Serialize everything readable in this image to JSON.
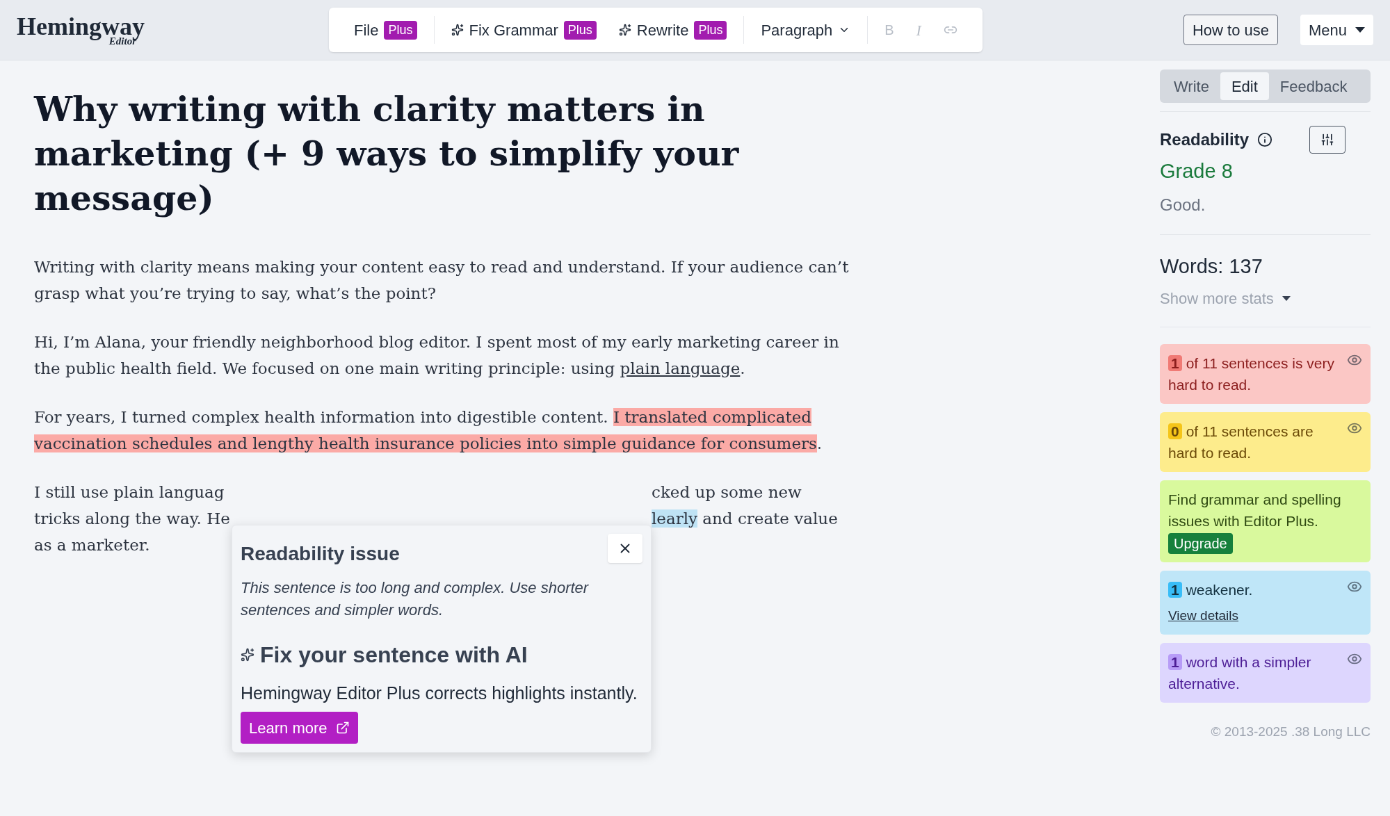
{
  "logo": {
    "name": "Hemingway",
    "sub": "Editor"
  },
  "toolbar": {
    "groups": [
      {
        "items": [
          {
            "kind": "menu",
            "label": "File",
            "badge": "Plus",
            "sparkle": false
          }
        ]
      },
      {
        "items": [
          {
            "kind": "menu",
            "label": "Fix Grammar",
            "badge": "Plus",
            "sparkle": true
          },
          {
            "kind": "menu",
            "label": "Rewrite",
            "badge": "Plus",
            "sparkle": true
          }
        ]
      },
      {
        "items": [
          {
            "kind": "dropdown",
            "label": "Paragraph"
          }
        ]
      },
      {
        "items": [
          {
            "kind": "bold",
            "label": "B"
          },
          {
            "kind": "italic",
            "label": "I"
          },
          {
            "kind": "link"
          }
        ]
      }
    ]
  },
  "header_buttons": [
    {
      "kind": "outline",
      "label": "How to use"
    },
    {
      "kind": "dropdown",
      "label": "Menu"
    }
  ],
  "document": {
    "title": "Why writing with clarity matters in marketing (+ 9 ways to simplify your message)",
    "paragraphs": [
      [
        {
          "kind": "text",
          "text": "Writing with clarity means making your content easy to read and understand. If your audience can’t grasp what you’re trying to say, what’s the point?"
        }
      ],
      [
        {
          "kind": "text",
          "text": "Hi, I’m Alana, your friendly neighborhood blog editor. I spent most of my early marketing career in the public health field. We focused on one main writing principle: using "
        },
        {
          "kind": "link",
          "text": "plain language"
        },
        {
          "kind": "text",
          "text": "."
        }
      ],
      [
        {
          "kind": "text",
          "text": "For years, I turned complex health information into digestible content. "
        },
        {
          "kind": "hard",
          "text": "I translated complicated vaccination schedules and lengthy health insurance policies into simple guidance for consumers"
        },
        {
          "kind": "text",
          "text": "."
        }
      ]
    ],
    "covered_paragraph": [
      {
        "left": [
          {
            "kind": "text",
            "text": "I still use plain languag"
          }
        ],
        "right": [
          {
            "kind": "text",
            "text": "cked up some new"
          }
        ]
      },
      {
        "left": [
          {
            "kind": "text",
            "text": "tricks along the way. He"
          }
        ],
        "right": [
          {
            "kind": "weak",
            "text": "learly"
          },
          {
            "kind": "text",
            "text": " and create value"
          }
        ]
      },
      {
        "left": [
          {
            "kind": "text",
            "text": "as a marketer."
          }
        ]
      }
    ]
  },
  "popup": {
    "title": "Readability issue",
    "description": "This sentence is too long and complex. Use shorter sentences and simpler words.",
    "heading": "Fix your sentence with AI",
    "body": "Hemingway Editor Plus corrects highlights instantly.",
    "button": "Learn more"
  },
  "sidebar": {
    "tabs": [
      {
        "label": "Write",
        "selected": false
      },
      {
        "label": "Edit",
        "selected": true
      },
      {
        "label": "Feedback",
        "selected": false
      }
    ],
    "readability": {
      "label": "Readability",
      "grade": "Grade 8",
      "verdict": "Good."
    },
    "words": "Words: 137",
    "more_stats": "Show more stats",
    "cards": [
      {
        "kind": "very_hard",
        "count": "1",
        "text": "of 11 sentences is very hard to read."
      },
      {
        "kind": "hard",
        "count": "0",
        "text": "of 11 sentences are hard to read."
      },
      {
        "kind": "promo",
        "text": "Find grammar and spelling issues with Editor Plus.",
        "button": "Upgrade"
      },
      {
        "kind": "weakener",
        "count": "1",
        "text": "weakener.",
        "link": "View details"
      },
      {
        "kind": "simpler",
        "count": "1",
        "text": "word with a simpler alternative."
      }
    ],
    "copyright": "© 2013-2025 .38 Long LLC"
  }
}
